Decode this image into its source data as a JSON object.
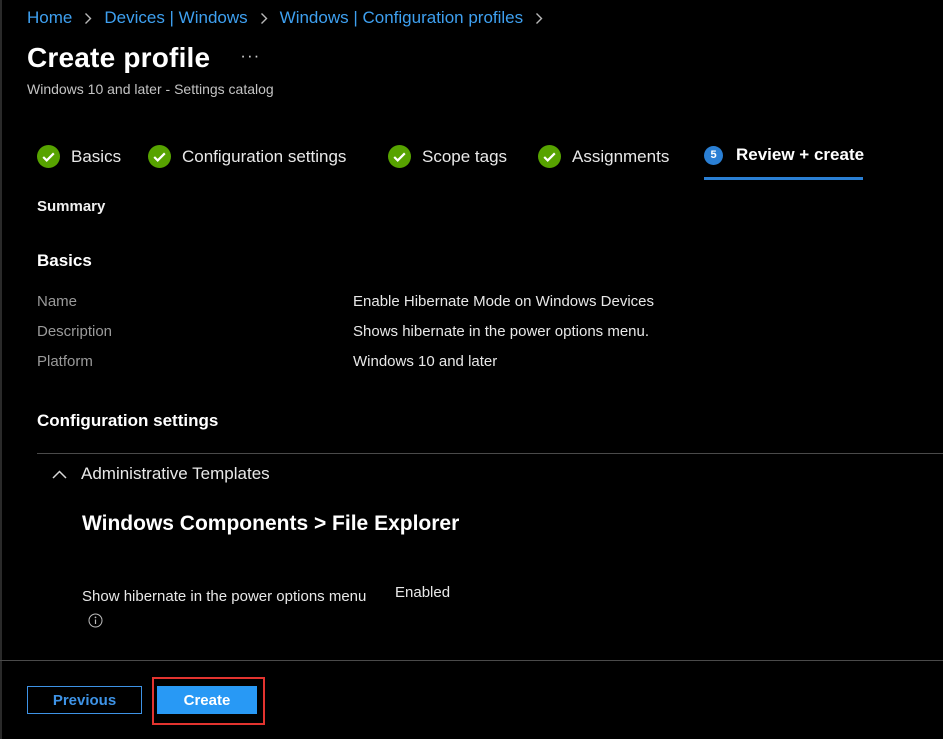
{
  "breadcrumb": {
    "items": [
      "Home",
      "Devices | Windows",
      "Windows | Configuration profiles"
    ]
  },
  "header": {
    "title": "Create profile",
    "more": "···",
    "subtitle": "Windows 10 and later - Settings catalog"
  },
  "tabs": [
    {
      "label": "Basics",
      "status": "complete"
    },
    {
      "label": "Configuration settings",
      "status": "complete"
    },
    {
      "label": "Scope tags",
      "status": "complete"
    },
    {
      "label": "Assignments",
      "status": "complete"
    },
    {
      "label": "Review + create",
      "status": "current",
      "step": "5"
    }
  ],
  "summary": {
    "heading": "Summary",
    "basics": {
      "heading": "Basics",
      "rows": [
        {
          "label": "Name",
          "value": "Enable Hibernate Mode on Windows Devices"
        },
        {
          "label": "Description",
          "value": "Shows hibernate in the power options menu."
        },
        {
          "label": "Platform",
          "value": "Windows 10 and later"
        }
      ]
    },
    "config": {
      "heading": "Configuration settings",
      "group": "Administrative Templates",
      "category": "Windows Components > File Explorer",
      "setting": {
        "name": "Show hibernate in the power options menu",
        "value": "Enabled"
      }
    }
  },
  "footer": {
    "previous": "Previous",
    "create": "Create"
  },
  "colors": {
    "link": "#3ea0f0",
    "accent": "#2a7fd4",
    "success": "#57a300",
    "primary_button": "#2899f5",
    "highlight": "#e3342f"
  }
}
